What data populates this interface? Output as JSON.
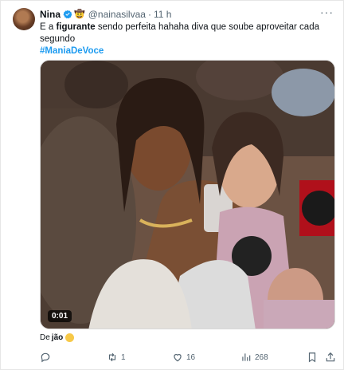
{
  "tweet": {
    "author_name": "Nina",
    "handle": "@nainasilvaa",
    "separator": "·",
    "time": "11 h",
    "more_label": "···",
    "text_prefix": "E a ",
    "text_bold": "figurante",
    "text_rest": " sendo perfeita hahaha diva que soube aproveitar cada segundo",
    "hashtag": "#ManiaDeVoce",
    "video_duration": "0:01",
    "caption_prefix": "De",
    "caption_bold": "jão",
    "accent_color": "#1d9bf0",
    "icons": {
      "verified": "verified-badge-icon",
      "crown": "crown-emoji-icon",
      "reply": "reply-icon",
      "retweet": "retweet-icon",
      "like": "like-icon",
      "views": "views-icon",
      "bookmark": "bookmark-icon",
      "share": "share-icon"
    }
  },
  "actions": {
    "reply_count": "",
    "retweet_count": "1",
    "like_count": "16",
    "view_count": "268"
  }
}
